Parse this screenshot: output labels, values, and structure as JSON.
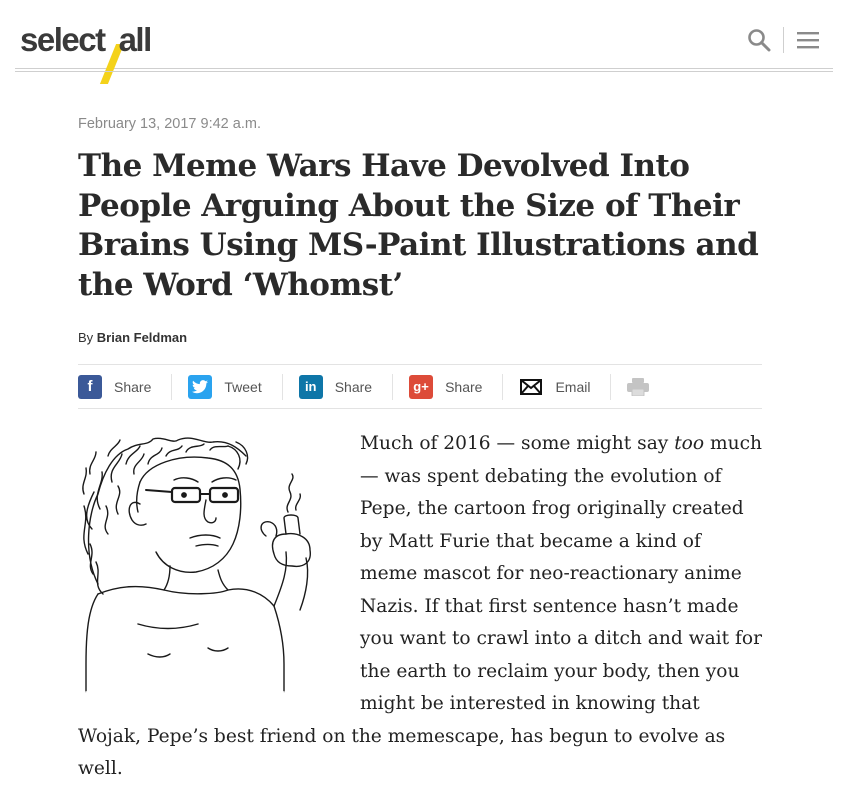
{
  "header": {
    "logo": {
      "left": "select",
      "right": "all"
    },
    "search_icon": "search-icon",
    "menu_icon": "hamburger-menu-icon"
  },
  "article": {
    "date": "February 13, 2017 9:42 a.m.",
    "headline": "The Meme Wars Have Devolved Into People Arguing About the Size of Their Brains Using MS-Paint Illustrations and the Word ‘Whomst’",
    "byline_prefix": "By",
    "author": "Brian Feldman",
    "share": [
      {
        "label": "Share",
        "icon": "facebook-icon",
        "glyph": "f",
        "color": "#3b5998"
      },
      {
        "label": "Tweet",
        "icon": "twitter-icon",
        "glyph": "t",
        "color": "#2aa3ef"
      },
      {
        "label": "Share",
        "icon": "linkedin-icon",
        "glyph": "in",
        "color": "#0e76a8"
      },
      {
        "label": "Share",
        "icon": "google-plus-icon",
        "glyph": "g+",
        "color": "#dd4b39"
      },
      {
        "label": "Email",
        "icon": "email-icon",
        "glyph": "✉",
        "color": "#222222"
      }
    ],
    "print_icon": "print-icon",
    "body_intro": "Much of 2016 — some might say ",
    "body_em": "too",
    "body_rest": " much — was spent debating the evolution of Pepe, the cartoon frog originally created by Matt Furie that became a kind of meme mascot for neo-reactionary anime Nazis. If that first sentence hasn’t made you want to crawl into a ditch and wait for the earth to reclaim your body, then you might be interested in knowing that Wojak, Pepe’s best friend on the memescape, has begun to evolve as well."
  },
  "colors": {
    "accent": "#f4d21a",
    "text": "#222222",
    "muted": "#8a8a8a"
  }
}
